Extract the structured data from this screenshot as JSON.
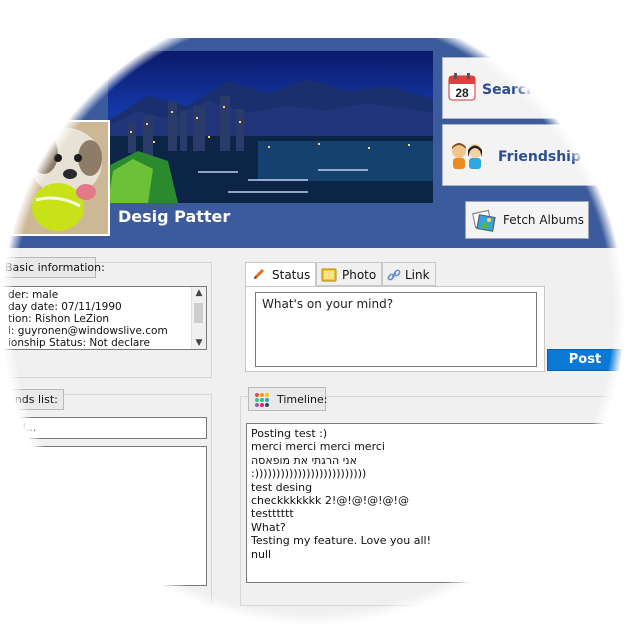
{
  "profile": {
    "name": "Desig Patter"
  },
  "actions": {
    "search_label": "Search",
    "friendship_label": "Friendship T",
    "fetch_albums_label": "Fetch Albums"
  },
  "basic_info": {
    "tag": "Basic information:",
    "lines": [
      "der: male",
      "day date: 07/11/1990",
      "tion: Rishon LeZion",
      "l: guyronen@windowslive.com",
      "ionship Status: Not declare"
    ]
  },
  "friends": {
    "tag": "iends list:",
    "search_value": "end..."
  },
  "composer": {
    "tabs": [
      "Status",
      "Photo",
      "Link"
    ],
    "placeholder": "What's on your mind?",
    "post_label": "Post"
  },
  "timeline": {
    "tag": "Timeline:",
    "posts": [
      "Posting test :)",
      "merci merci merci merci",
      "אני הרגתי את מופאסה",
      ":))))))))))))))))))))))))))",
      "test desing",
      "checkkkkkkk 2!@!@!@!@!@",
      "testttttt",
      "What?",
      "Testing my feature. Love you all!",
      "null"
    ]
  },
  "colors": {
    "header_blue": "#3b5b9c",
    "post_button": "#0a78d7",
    "link_text": "#2a4d92"
  },
  "icons": {
    "calendar": "calendar-icon",
    "friends": "friends-icon",
    "albums": "albums-icon",
    "status": "pencil-icon",
    "photo": "photo-icon",
    "link": "link-icon",
    "timeline": "grid-icon"
  }
}
